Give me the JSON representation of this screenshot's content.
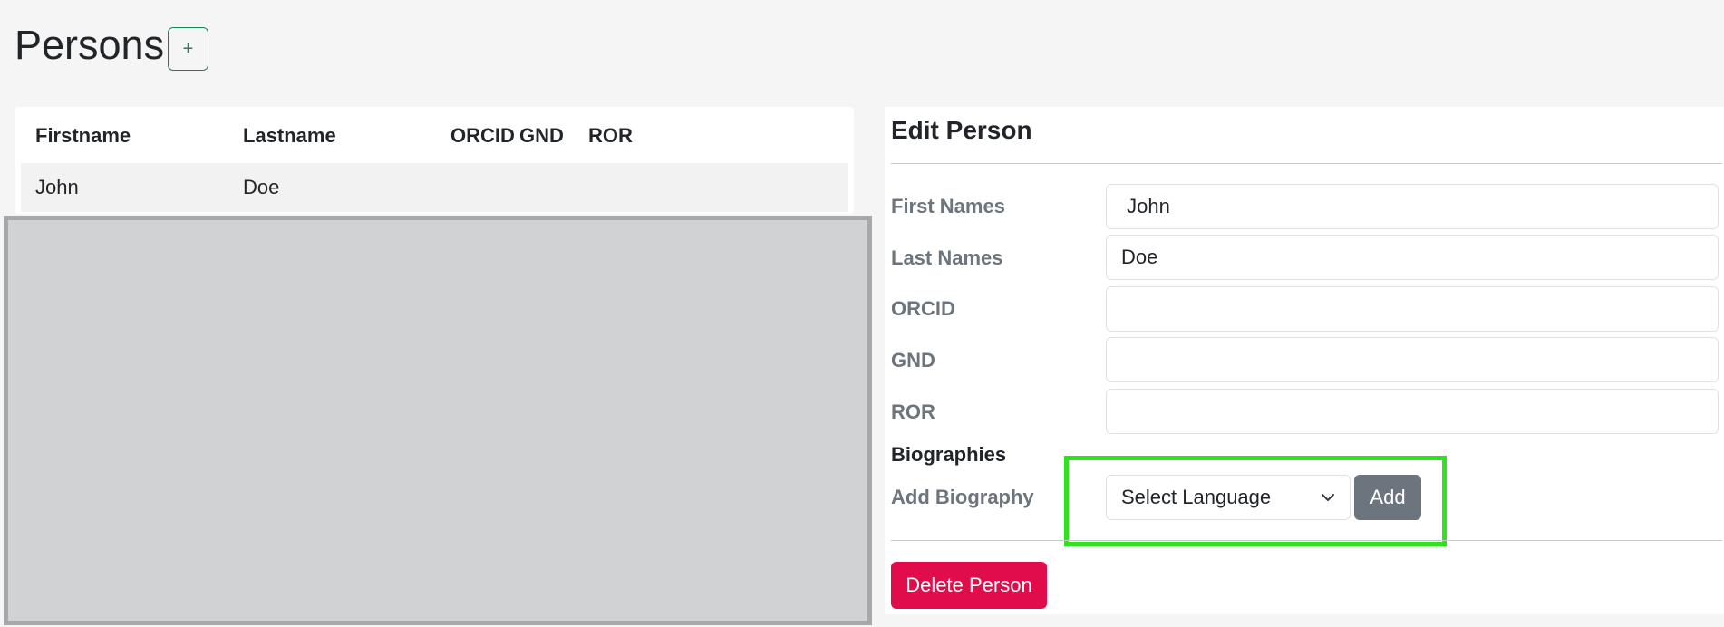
{
  "page": {
    "title": "Persons",
    "add_button_label": "+"
  },
  "table": {
    "columns": [
      "Firstname",
      "Lastname",
      "ORCID",
      "GND",
      "ROR"
    ],
    "rows": [
      {
        "firstname": "John",
        "lastname": "Doe",
        "orcid": "",
        "gnd": "",
        "ror": ""
      }
    ]
  },
  "edit": {
    "title": "Edit Person",
    "fields": [
      {
        "label": "First Names",
        "value": " John"
      },
      {
        "label": "Last Names",
        "value": "Doe"
      },
      {
        "label": "ORCID",
        "value": ""
      },
      {
        "label": "GND",
        "value": ""
      },
      {
        "label": "ROR",
        "value": ""
      }
    ],
    "biographies_heading": "Biographies",
    "add_biography_label": "Add Biography",
    "language_select_value": "Select Language",
    "add_button_label": "Add",
    "delete_button_label": "Delete Person"
  },
  "colors": {
    "accent_green": "#198754",
    "delete_red": "#e00d4a",
    "secondary_gray": "#6c757d",
    "highlight_green": "#2ee21c",
    "overlay_gray": "#d1d2d4"
  },
  "icons": {
    "select_chevron": "chevron-down-icon"
  }
}
